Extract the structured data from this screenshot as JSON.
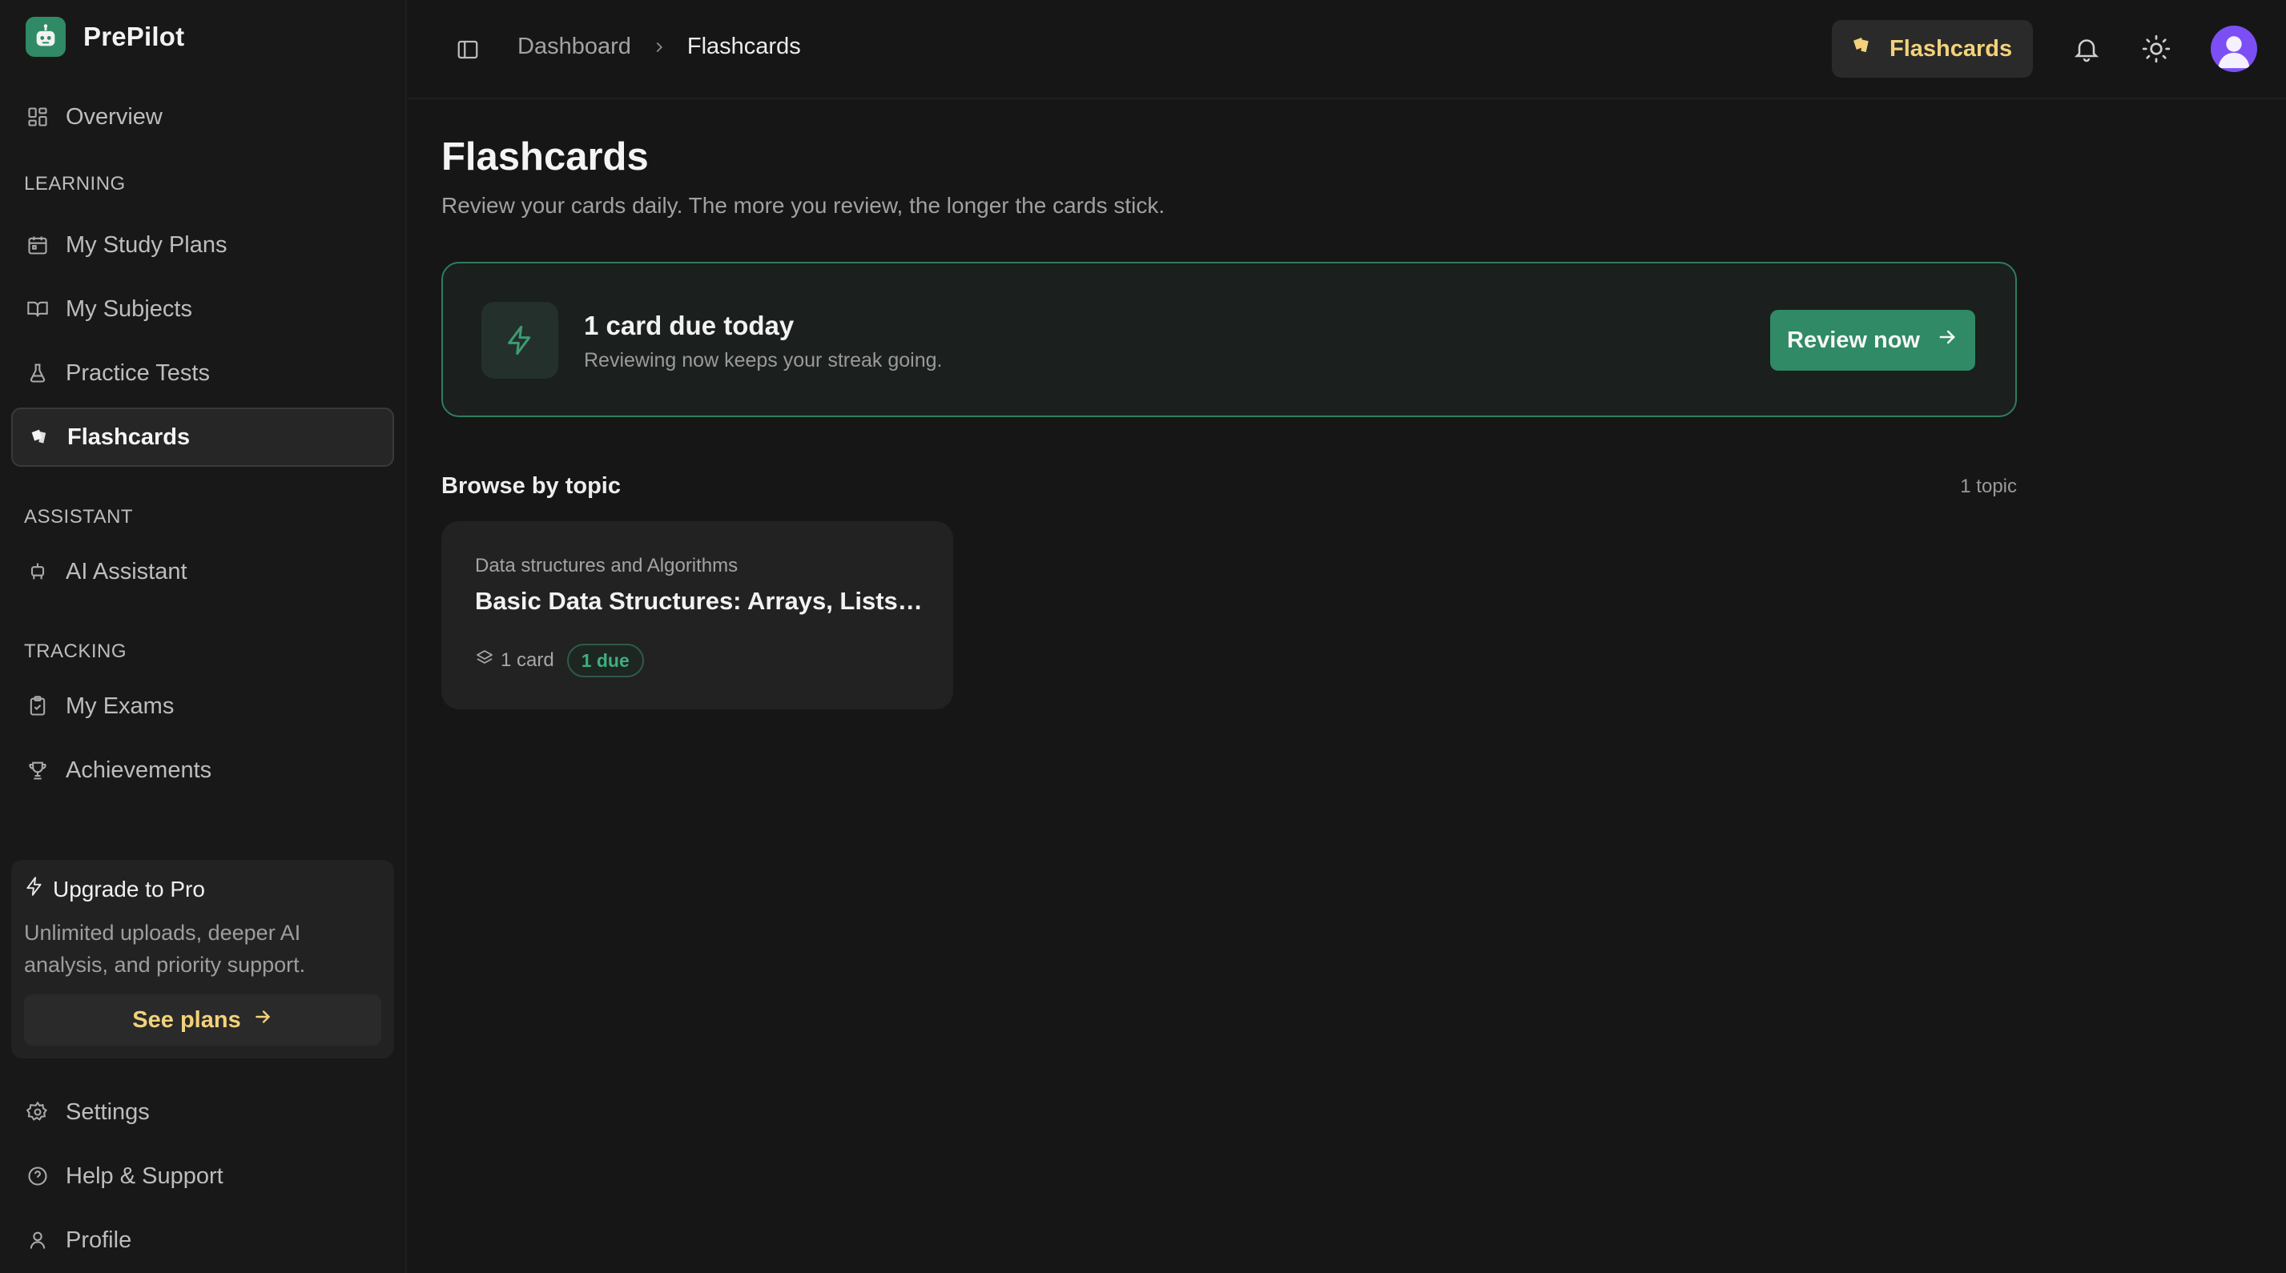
{
  "app": {
    "name": "PrePilot",
    "logo_icon": "robot-icon",
    "accent": "#2f8a65",
    "highlight": "#f2d27a"
  },
  "sidebar": {
    "overview": {
      "label": "Overview",
      "icon": "grid-icon"
    },
    "sections": [
      {
        "label": "LEARNING",
        "items": [
          {
            "label": "My Study Plans",
            "icon": "calendar-icon"
          },
          {
            "label": "My Subjects",
            "icon": "book-icon"
          },
          {
            "label": "Practice Tests",
            "icon": "flask-icon"
          },
          {
            "label": "Flashcards",
            "icon": "cards-icon",
            "active": true
          }
        ]
      },
      {
        "label": "ASSISTANT",
        "items": [
          {
            "label": "AI Assistant",
            "icon": "bot-icon"
          }
        ]
      },
      {
        "label": "TRACKING",
        "items": [
          {
            "label": "My Exams",
            "icon": "clipboard-icon"
          },
          {
            "label": "Achievements",
            "icon": "trophy-icon"
          }
        ]
      }
    ],
    "upgrade": {
      "title": "Upgrade to Pro",
      "description": "Unlimited uploads, deeper AI analysis, and priority support.",
      "button": "See plans"
    },
    "footer": [
      {
        "label": "Settings",
        "icon": "gear-icon"
      },
      {
        "label": "Help & Support",
        "icon": "help-circle-icon"
      },
      {
        "label": "Profile",
        "icon": "user-icon"
      }
    ]
  },
  "header": {
    "breadcrumb": [
      "Dashboard",
      "Flashcards"
    ],
    "pill_label": "Flashcards"
  },
  "main": {
    "title": "Flashcards",
    "subtitle": "Review your cards daily. The more you review, the longer the cards stick.",
    "due": {
      "title": "1 card due today",
      "subtitle": "Reviewing now keeps your streak going.",
      "button": "Review now"
    },
    "browse": {
      "title": "Browse by topic",
      "count": "1 topic",
      "topics": [
        {
          "category": "Data structures and Algorithms",
          "title": "Basic Data Structures: Arrays, Lists, Stacks, and Queues",
          "cards": "1 card",
          "due": "1 due"
        }
      ]
    }
  }
}
